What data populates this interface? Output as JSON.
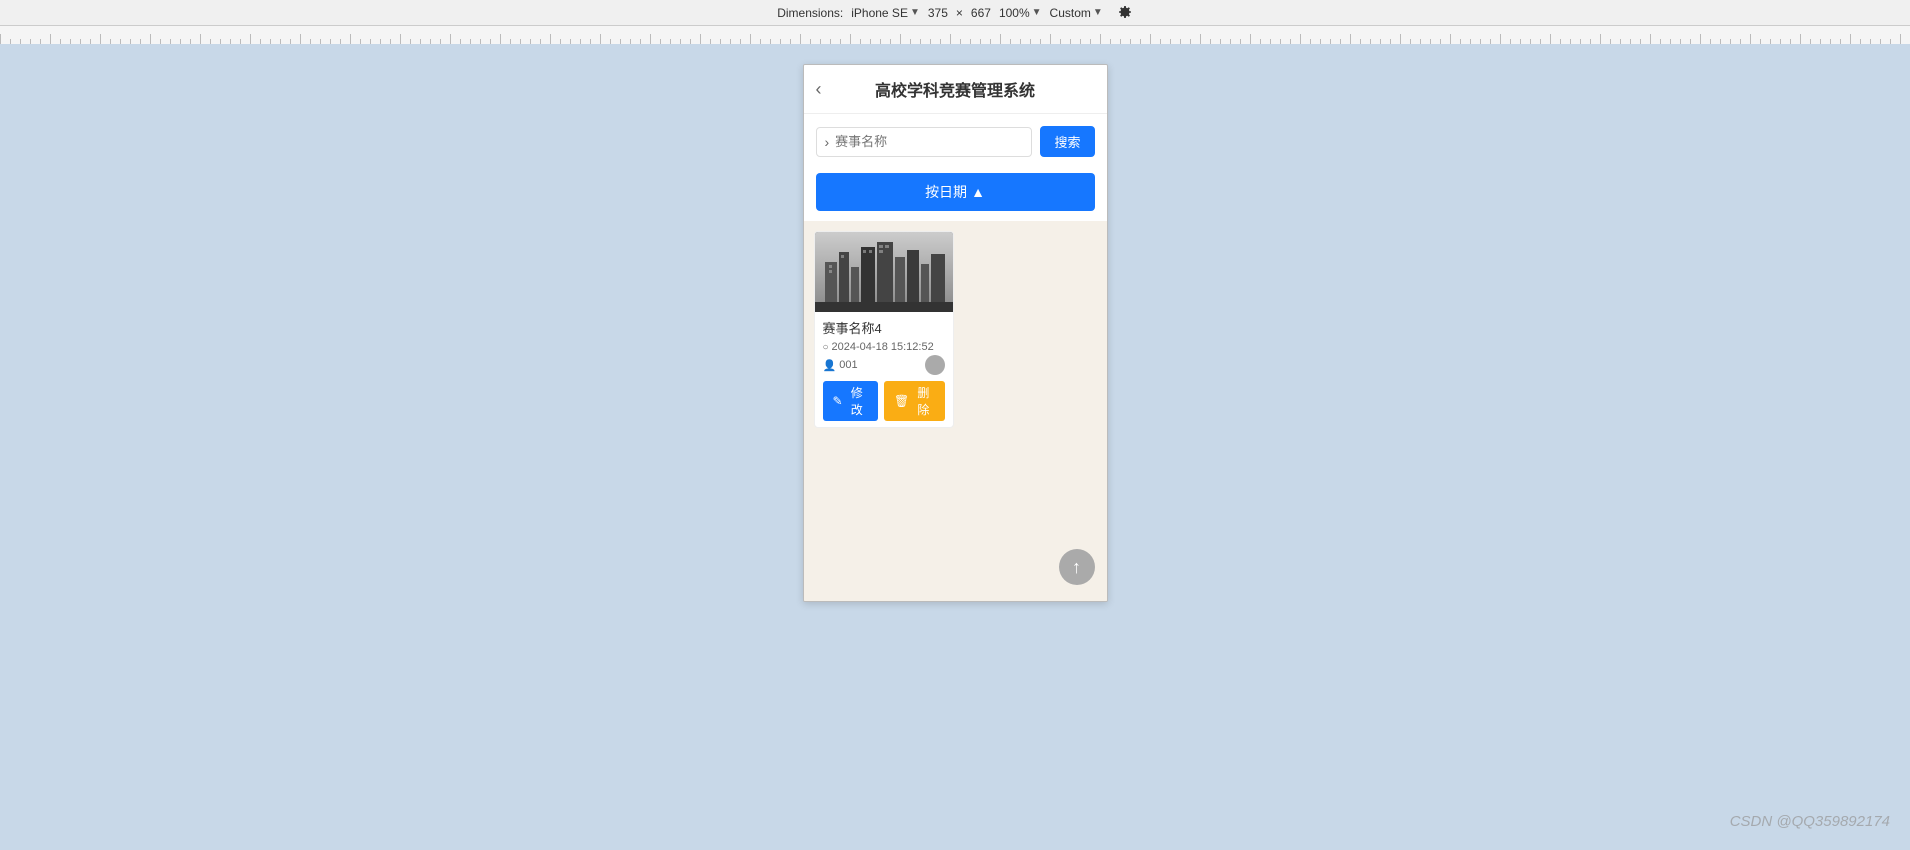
{
  "topbar": {
    "dimensions_label": "Dimensions:",
    "device": "iPhone SE",
    "width": "375",
    "x_separator": "×",
    "height": "667",
    "zoom": "100%",
    "custom": "Custom",
    "settings_icon": "settings-icon"
  },
  "app": {
    "title": "高校学科竞赛管理系统",
    "back_icon": "‹",
    "search": {
      "placeholder": "赛事名称",
      "arrow_icon": "›",
      "button_label": "搜索"
    },
    "sort_button": {
      "label": "按日期",
      "icon": "▲"
    },
    "card": {
      "title": "赛事名称4",
      "date": "2024-04-18 15:12:52",
      "user_id": "001",
      "edit_label": "修改",
      "delete_label": "删除",
      "edit_icon": "✎",
      "delete_icon": "🗑"
    },
    "scroll_top_icon": "↑"
  },
  "watermark": "CSDN @QQ359892174"
}
